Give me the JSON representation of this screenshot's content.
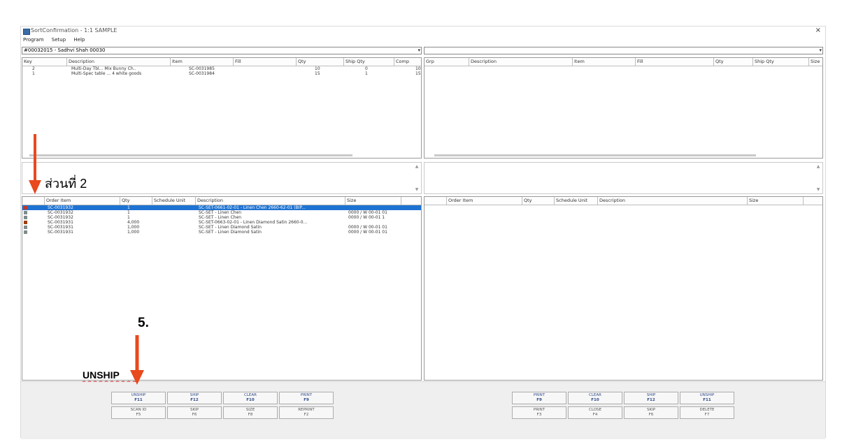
{
  "window": {
    "title": "SortConfirmation - 1:1 SAMPLE"
  },
  "menu": [
    "Program",
    "Setup",
    "Help"
  ],
  "top_left_combo": "#00032015 - Sadhvi Shah 00030",
  "top_left_grid": {
    "columns": [
      "Key",
      "Description",
      "Item",
      "Fill",
      "Qty",
      "Ship Qty",
      "Comp"
    ],
    "rows": [
      {
        "key": "2",
        "desc": "Multi-Day Tbl... Mix Bunny Ch..",
        "item": "SC-0031985",
        "fill": "",
        "qty": "10",
        "ship": "0",
        "comp": "10"
      },
      {
        "key": "1",
        "desc": "Multi-Spec table ... 4 white goods",
        "item": "SC-0031984",
        "fill": "",
        "qty": "15",
        "ship": "1",
        "comp": "15"
      }
    ]
  },
  "top_right_grid": {
    "columns": [
      "Grp",
      "Description",
      "Item",
      "Fill",
      "Qty",
      "Ship Qty",
      "Size"
    ]
  },
  "bottom_left_grid": {
    "columns": [
      "",
      "Order Item",
      "Qty",
      "Schedule Unit",
      "Description",
      "Size"
    ],
    "rows": [
      {
        "order": "SC-0031932",
        "qty": "1",
        "sched": "",
        "desc": "SC-SET-0661-02-01 - Linen Chen 2660-62-01 (BIP...",
        "size": "",
        "selected": true
      },
      {
        "order": "SC-0031932",
        "qty": "1",
        "sched": "",
        "desc": "SC-SET - Linen Chen",
        "size": "0000 / W 00-01 01",
        "selected": false
      },
      {
        "order": "SC-0031932",
        "qty": "1",
        "sched": "",
        "desc": "SC-SET - Linen Chen",
        "size": "0000 / W 00-01 1",
        "selected": false
      },
      {
        "order": "SC-0031931",
        "qty": "4,000",
        "sched": "",
        "desc": "SC-SET-0663-02-01 - Linen Diamond Satin 2660-0...",
        "size": "",
        "selected": false
      },
      {
        "order": "SC-0031931",
        "qty": "1,000",
        "sched": "",
        "desc": "SC-SET - Linen Diamond Satin",
        "size": "0000 / W 00-01 01",
        "selected": false
      },
      {
        "order": "SC-0031931",
        "qty": "1,000",
        "sched": "",
        "desc": "SC-SET - Linen Diamond Satin",
        "size": "0000 / W 00-01 01",
        "selected": false
      }
    ]
  },
  "bottom_right_grid": {
    "columns": [
      "",
      "Order Item",
      "Qty",
      "Schedule Unit",
      "Description",
      "Size"
    ]
  },
  "left_buttons": [
    {
      "l1": "UNSHIP",
      "l2": "F11"
    },
    {
      "l1": "SHIP",
      "l2": "F12"
    },
    {
      "l1": "CLEAR",
      "l2": "F10"
    },
    {
      "l1": "PRINT",
      "l2": "F9"
    },
    {
      "l1": "SCAN ID",
      "l2": "F5"
    },
    {
      "l1": "SKIP",
      "l2": "F6"
    },
    {
      "l1": "SIZE",
      "l2": "F8"
    },
    {
      "l1": "REPRINT",
      "l2": "F2"
    }
  ],
  "right_buttons": [
    {
      "l1": "PRINT",
      "l2": "F9"
    },
    {
      "l1": "CLEAR",
      "l2": "F10"
    },
    {
      "l1": "SHIP",
      "l2": "F12"
    },
    {
      "l1": "UNSHIP",
      "l2": "F11"
    },
    {
      "l1": "PRINT",
      "l2": "F3"
    },
    {
      "l1": "CLOSE",
      "l2": "F4"
    },
    {
      "l1": "SKIP",
      "l2": "F6"
    },
    {
      "l1": "DELETE",
      "l2": "F7"
    }
  ],
  "annotations": {
    "section_label": "ส่วนที่ 2",
    "step_label": "5.",
    "unship_label": "UNSHIP"
  },
  "colors": {
    "arrow": "#e8491d",
    "selection": "#1e73d2",
    "underline": "#d03030"
  }
}
